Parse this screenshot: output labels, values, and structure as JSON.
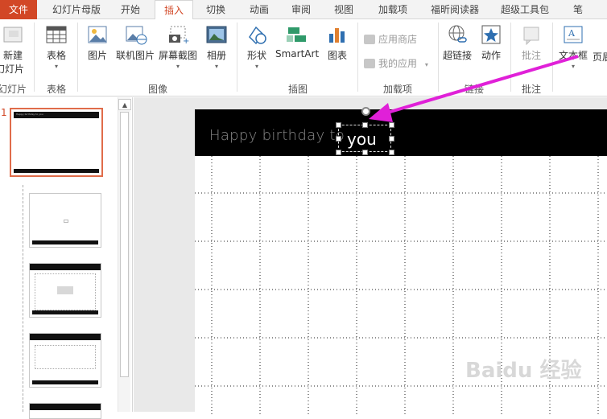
{
  "tabs": [
    {
      "label": "文件"
    },
    {
      "label": "幻灯片母版"
    },
    {
      "label": "开始"
    },
    {
      "label": "插入"
    },
    {
      "label": "切换"
    },
    {
      "label": "动画"
    },
    {
      "label": "审阅"
    },
    {
      "label": "视图"
    },
    {
      "label": "加载项"
    },
    {
      "label": "福昕阅读器"
    },
    {
      "label": "超级工具包"
    },
    {
      "label": "笔"
    }
  ],
  "ribbon": {
    "new_slide": "新建\n幻灯片",
    "new_slide_line1": "新建",
    "new_slide_line2": "幻灯片",
    "table": "表格",
    "picture": "图片",
    "online_picture": "联机图片",
    "screenshot": "屏幕截图",
    "album": "相册",
    "shapes": "形状",
    "smartart": "SmartArt",
    "chart": "图表",
    "store": "应用商店",
    "my_apps": "我的应用",
    "hyperlink": "超链接",
    "action": "动作",
    "comment": "批注",
    "textbox": "文本框",
    "header_footer": "页眉",
    "groups": {
      "slides": "幻灯片",
      "tables": "表格",
      "images": "图像",
      "illustrations": "插图",
      "addins": "加载项",
      "links": "链接",
      "comments": "批注"
    }
  },
  "thumbnails": {
    "slide_number": "1",
    "selected_title": "Happy birthday to you"
  },
  "slide": {
    "title": "Happy birthday to",
    "textbox_text": "you"
  },
  "watermark": "Baidu 经验",
  "colors": {
    "accent": "#d24726",
    "arrow": "#e020d8"
  }
}
